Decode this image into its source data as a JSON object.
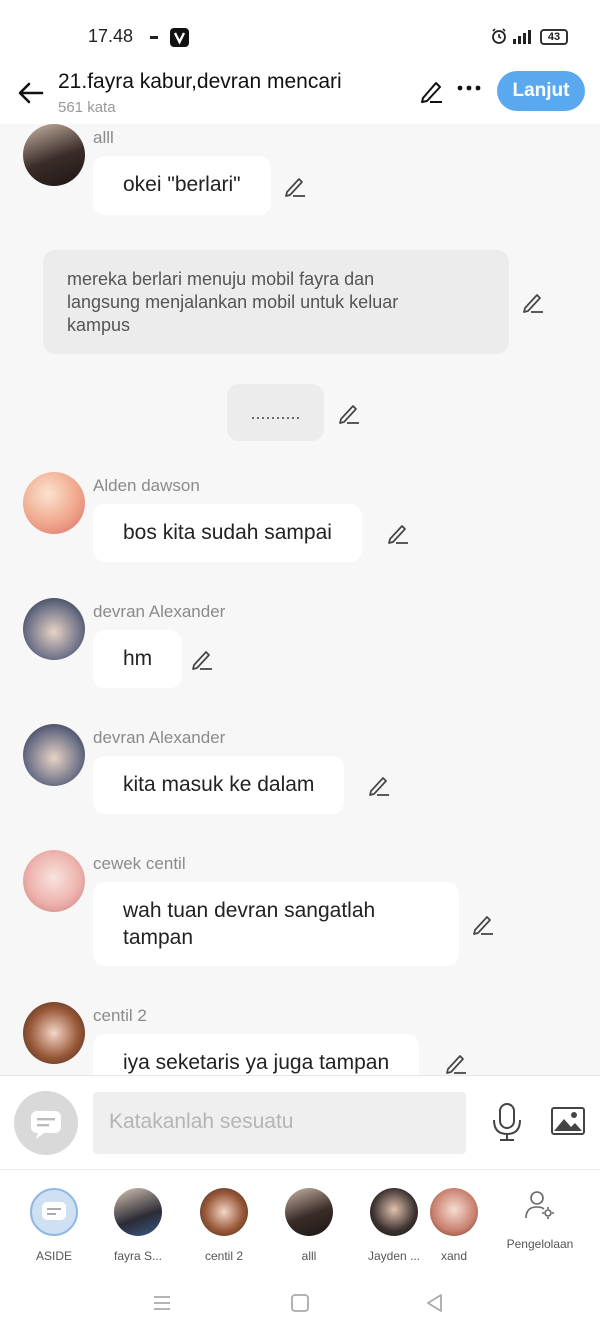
{
  "status_bar": {
    "time": "17.48",
    "battery": "43"
  },
  "header": {
    "title": "21.fayra kabur,devran mencari",
    "subtitle": "561 kata",
    "next_label": "Lanjut"
  },
  "messages": [
    {
      "name": "alll",
      "text": "okei \"berlari\""
    },
    {
      "narration": "mereka berlari menuju mobil fayra dan\nlangsung menjalankan mobil untuk keluar\nkampus"
    },
    {
      "narration": ".........."
    },
    {
      "name": "Alden dawson",
      "text": "bos kita sudah sampai"
    },
    {
      "name": "devran Alexander",
      "text": "hm"
    },
    {
      "name": "devran Alexander",
      "text": "kita masuk ke dalam"
    },
    {
      "name": "cewek centil",
      "text": "wah tuan devran sangatlah\ntampan"
    },
    {
      "name": "centil 2",
      "text": "iya seketaris ya juga tampan"
    }
  ],
  "composer": {
    "placeholder": "Katakanlah sesuatu"
  },
  "characters": [
    {
      "label": "ASIDE"
    },
    {
      "label": "fayra S..."
    },
    {
      "label": "centil 2"
    },
    {
      "label": "alll"
    },
    {
      "label": "Jayden ..."
    },
    {
      "label": "xand"
    }
  ],
  "manage_label": "Pengelolaan",
  "colors": {
    "accent": "#5aa9ee",
    "bubble": "#ffffff",
    "narration": "#ececec",
    "background": "#f7f7f7"
  }
}
